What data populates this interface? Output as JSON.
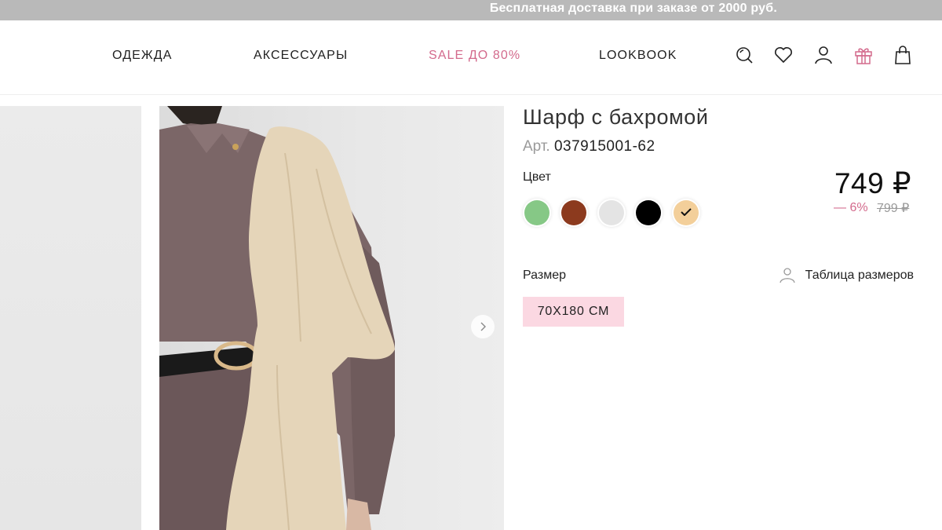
{
  "promo": {
    "text": "Бесплатная доставка при заказе от 2000 руб."
  },
  "nav": {
    "items": [
      {
        "label": "ОДЕЖДА"
      },
      {
        "label": "АКСЕССУАРЫ"
      },
      {
        "label": "SALE ДО 80%",
        "color": "#d36a8c"
      },
      {
        "label": "LOOKBOOK"
      }
    ],
    "icons": [
      "search-icon",
      "heart-icon",
      "user-icon",
      "gift-icon",
      "bag-icon"
    ]
  },
  "product": {
    "title": "Шарф с бахромой",
    "sku_label": "Арт.",
    "sku_value": "037915001-62",
    "color_label": "Цвет",
    "colors": [
      {
        "name": "green",
        "hex": "#86c886"
      },
      {
        "name": "brown",
        "hex": "#8c3a1e"
      },
      {
        "name": "light-gray",
        "hex": "#e4e4e4"
      },
      {
        "name": "black",
        "hex": "#000000"
      },
      {
        "name": "beige",
        "hex": "#f3cf9a",
        "selected": true
      }
    ],
    "price": "749 ₽",
    "discount": "— 6%",
    "old_price": "799 ₽",
    "size_label": "Размер",
    "size_table_label": "Таблица размеров",
    "sizes": [
      "70X180 СМ"
    ]
  },
  "colors": {
    "accent": "#d36a8c",
    "size_chip": "#fbd8e2",
    "promo_bg": "#b9b9b9"
  }
}
